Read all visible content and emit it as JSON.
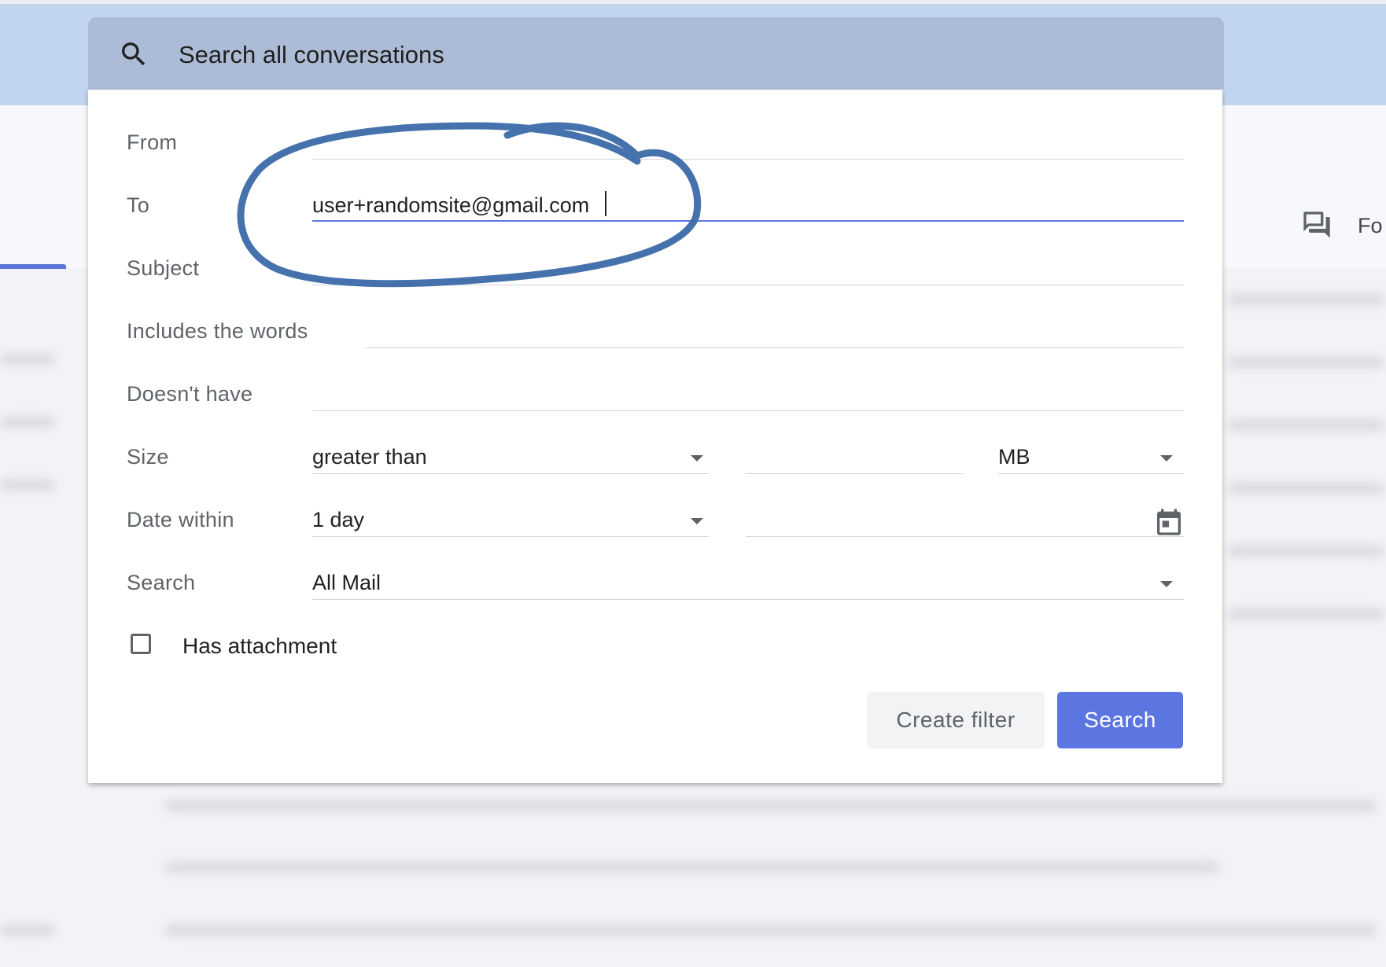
{
  "search_bar": {
    "placeholder": "Search all conversations",
    "icon": "search-icon"
  },
  "background": {
    "side_label": "Fo",
    "side_icon": "chat-icon"
  },
  "form": {
    "from": {
      "label": "From",
      "value": ""
    },
    "to": {
      "label": "To",
      "value": "user+randomsite@gmail.com"
    },
    "subject": {
      "label": "Subject",
      "value": ""
    },
    "includes": {
      "label": "Includes the words",
      "value": ""
    },
    "doesnt_have": {
      "label": "Doesn't have",
      "value": ""
    },
    "size": {
      "label": "Size",
      "operator": "greater than",
      "value": "",
      "unit": "MB"
    },
    "date_within": {
      "label": "Date within",
      "value": "1 day",
      "date": ""
    },
    "search_in": {
      "label": "Search",
      "value": "All Mail"
    },
    "has_attachment": {
      "label": "Has attachment",
      "checked": false
    }
  },
  "buttons": {
    "create_filter": "Create filter",
    "search": "Search"
  },
  "colors": {
    "accent": "#5b76e0",
    "header": "#c2d5ee",
    "search_bar": "#adbcd6",
    "annotation": "#3b6aa8"
  }
}
